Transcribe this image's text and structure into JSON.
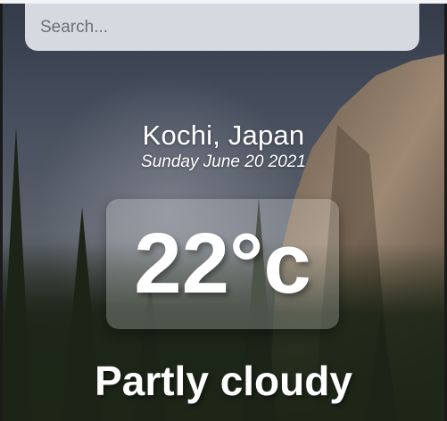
{
  "search": {
    "placeholder": "Search...",
    "value": ""
  },
  "weather": {
    "location": "Kochi, Japan",
    "date": "Sunday June 20 2021",
    "temperature": "22°c",
    "condition": "Partly cloudy"
  },
  "background": {
    "description_icon": "landscape-photo",
    "colors": {
      "sky": "#4b5363",
      "cliff": "#8a7662",
      "trees": "#1c2418"
    }
  },
  "colors": {
    "search_bg": "#d7d9e0",
    "text": "#ffffff",
    "card_bg": "rgba(255,255,255,0.22)"
  }
}
